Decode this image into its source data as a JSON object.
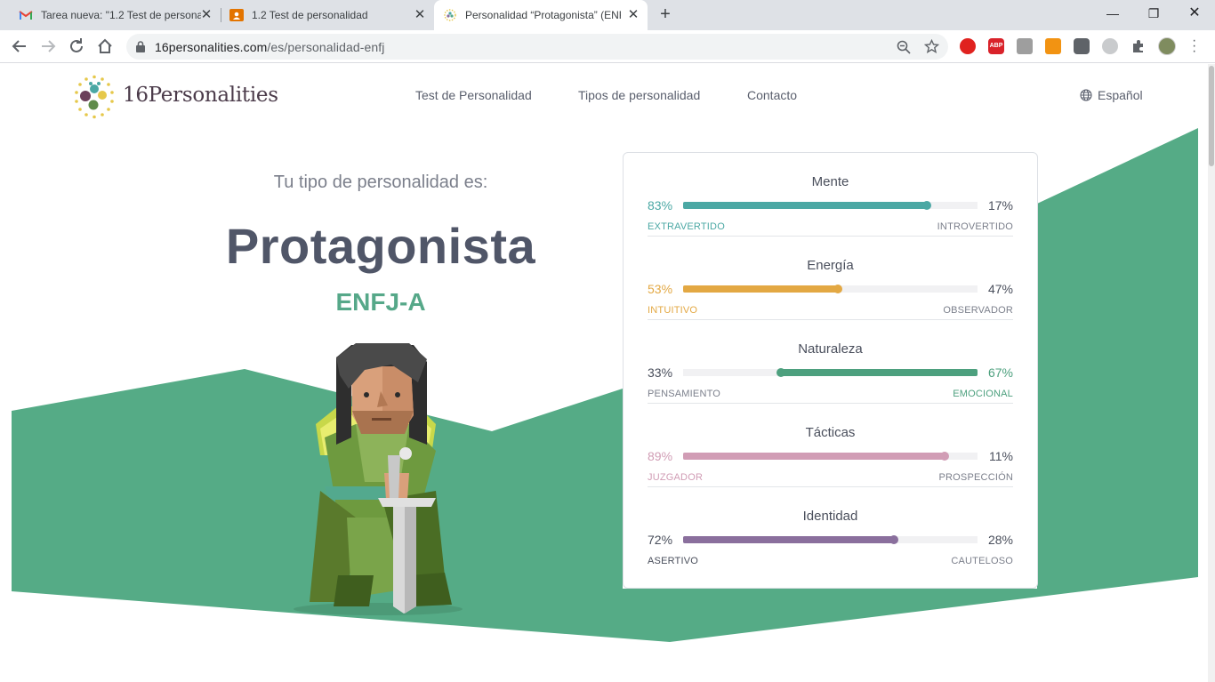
{
  "browser": {
    "tabs": [
      {
        "title": "Tarea nueva: \"1.2 Test de persona",
        "icon": "gmail-icon",
        "active": false
      },
      {
        "title": "1.2 Test de personalidad",
        "icon": "classroom-icon",
        "active": false
      },
      {
        "title": "Personalidad “Protagonista” (ENF",
        "icon": "16p-favicon",
        "active": true
      }
    ],
    "new_tab_label": "+",
    "url_host": "16personalities.com",
    "url_path": "/es/personalidad-enfj",
    "colors": {
      "tabstrip": "#dee1e6",
      "omnibox": "#f1f3f4"
    }
  },
  "site": {
    "logo_text": "16Personalities",
    "nav": [
      "Test de Personalidad",
      "Tipos de personalidad",
      "Contacto"
    ],
    "language": "Español"
  },
  "hero": {
    "subtitle": "Tu tipo de personalidad es:",
    "title": "Protagonista",
    "code": "ENFJ-A",
    "background_color": "#55ab86"
  },
  "traits": [
    {
      "name": "Mente",
      "left_pct": "83%",
      "right_pct": "17%",
      "left_label": "Extravertido",
      "right_label": "Introvertido",
      "fill": 0.83,
      "dominant": "left",
      "color": "#4ba8a4"
    },
    {
      "name": "Energía",
      "left_pct": "53%",
      "right_pct": "47%",
      "left_label": "Intuitivo",
      "right_label": "Observador",
      "fill": 0.53,
      "dominant": "left",
      "color": "#e3a843"
    },
    {
      "name": "Naturaleza",
      "left_pct": "33%",
      "right_pct": "67%",
      "left_label": "Pensamiento",
      "right_label": "Emocional",
      "fill": 0.67,
      "dominant": "right",
      "color": "#4da07e"
    },
    {
      "name": "Tácticas",
      "left_pct": "89%",
      "right_pct": "11%",
      "left_label": "Juzgador",
      "right_label": "Prospección",
      "fill": 0.89,
      "dominant": "left",
      "color": "#d19db5"
    },
    {
      "name": "Identidad",
      "left_pct": "72%",
      "right_pct": "28%",
      "left_label": "Asertivo",
      "right_label": "Cauteloso",
      "fill": 0.72,
      "dominant": "left",
      "color": "#8a6f9d"
    }
  ]
}
